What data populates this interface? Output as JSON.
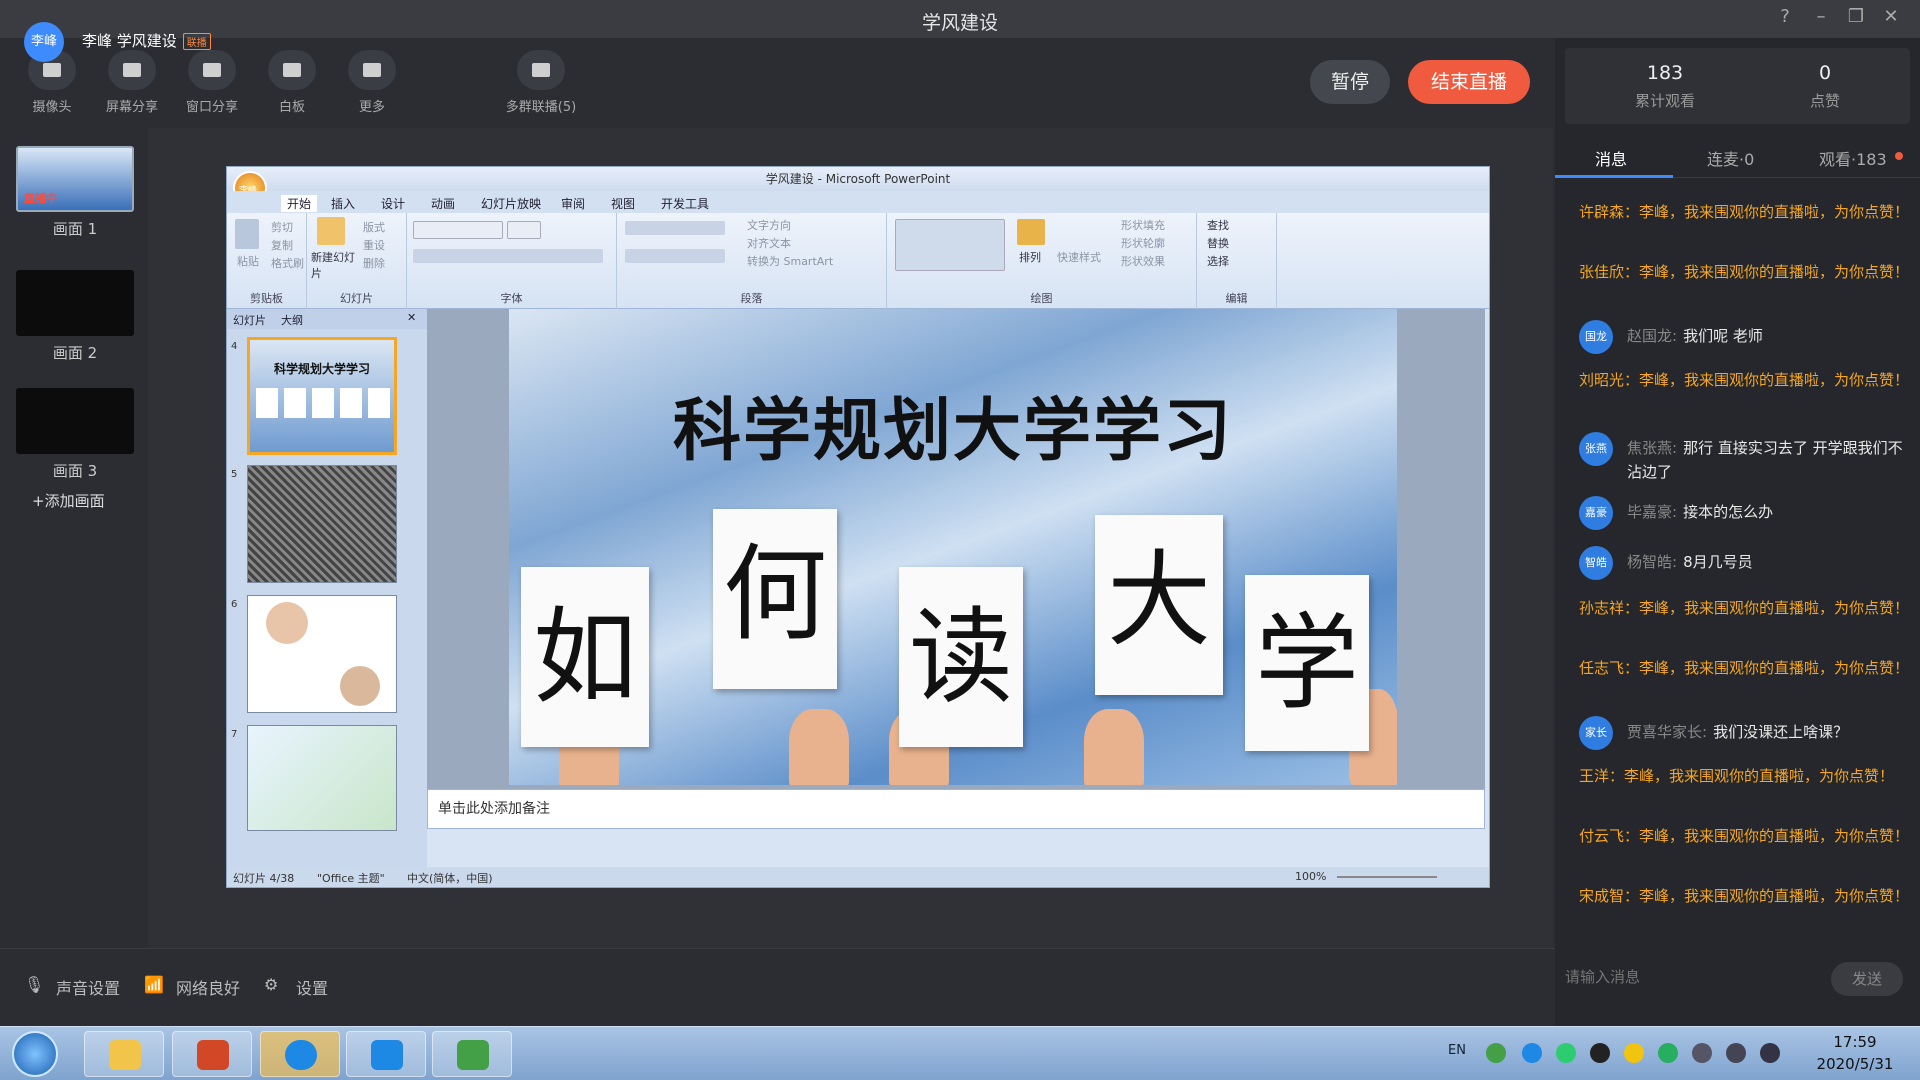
{
  "window": {
    "title": "学风建设"
  },
  "host": {
    "avatar_text": "李峰",
    "name_line": "李峰 学风建设",
    "tag": "联播"
  },
  "toolbar": {
    "tools": [
      {
        "label": "摄像头",
        "icon": "camera-icon"
      },
      {
        "label": "屏幕分享",
        "icon": "screen-share-icon"
      },
      {
        "label": "窗口分享",
        "icon": "window-share-icon"
      },
      {
        "label": "白板",
        "icon": "whiteboard-icon"
      },
      {
        "label": "更多",
        "icon": "grid-icon"
      },
      {
        "label": "多群联播(5)",
        "icon": "multi-group-icon"
      }
    ],
    "pause": "暂停",
    "end_live": "结束直播"
  },
  "scenes": {
    "items": [
      {
        "label": "画面 1",
        "badge": "直播中"
      },
      {
        "label": "画面 2"
      },
      {
        "label": "画面 3"
      }
    ],
    "add": "+添加画面"
  },
  "ppt": {
    "title": "学风建设 - Microsoft PowerPoint",
    "office_badge": "李峰",
    "tabs": [
      "开始",
      "插入",
      "设计",
      "动画",
      "幻灯片放映",
      "审阅",
      "视图",
      "开发工具"
    ],
    "ribbon": {
      "clipboard": {
        "label": "剪贴板",
        "paste": "粘贴",
        "cut": "剪切",
        "copy": "复制",
        "painter": "格式刷"
      },
      "slides": {
        "label": "幻灯片",
        "new_slide": "新建幻灯片",
        "layout": "版式",
        "reset": "重设",
        "delete": "删除"
      },
      "font": {
        "label": "字体"
      },
      "paragraph": {
        "label": "段落",
        "direction": "文字方向",
        "align": "对齐文本",
        "smartart": "转换为 SmartArt"
      },
      "drawing": {
        "label": "绘图",
        "arrange": "排列",
        "quick": "快速样式",
        "fill": "形状填充",
        "outline": "形状轮廓",
        "effect": "形状效果"
      },
      "editing": {
        "label": "编辑",
        "find": "查找",
        "replace": "替换",
        "select": "选择"
      }
    },
    "pane_tabs": [
      "幻灯片",
      "大纲"
    ],
    "thumbs": [
      {
        "num": "4",
        "title": "科学规划大学学习"
      },
      {
        "num": "5"
      },
      {
        "num": "6"
      },
      {
        "num": "7"
      }
    ],
    "slide": {
      "title": "科学规划大学学习",
      "cards": [
        "如",
        "何",
        "读",
        "大",
        "学"
      ]
    },
    "notes_placeholder": "单击此处添加备注",
    "status": {
      "slide": "幻灯片 4/38",
      "theme": "\"Office 主题\"",
      "lang": "中文(简体，中国)",
      "zoom": "100%"
    }
  },
  "right": {
    "stats": [
      {
        "value": "183",
        "label": "累计观看"
      },
      {
        "value": "0",
        "label": "点赞"
      }
    ],
    "tabs": [
      "消息",
      "连麦·0",
      "观看·183"
    ],
    "chat": [
      {
        "type": "sys",
        "text": "许辟森：李峰，我来围观你的直播啦，为你点赞！"
      },
      {
        "type": "sys",
        "text": "张佳欣：李峰，我来围观你的直播啦，为你点赞！"
      },
      {
        "type": "user",
        "avatar": "国龙",
        "name": "赵国龙:",
        "text": "我们呢  老师"
      },
      {
        "type": "sys",
        "text": "刘昭光：李峰，我来围观你的直播啦，为你点赞！"
      },
      {
        "type": "user",
        "avatar": "张燕",
        "name": "焦张燕:",
        "text": "那行 直接实习去了 开学跟我们不沾边了"
      },
      {
        "type": "user",
        "avatar": "嘉豪",
        "name": "毕嘉豪:",
        "text": "接本的怎么办"
      },
      {
        "type": "user",
        "avatar": "智皓",
        "name": "杨智皓:",
        "text": "8月几号员"
      },
      {
        "type": "sys",
        "text": "孙志祥：李峰，我来围观你的直播啦，为你点赞！"
      },
      {
        "type": "sys",
        "text": "任志飞：李峰，我来围观你的直播啦，为你点赞！"
      },
      {
        "type": "user",
        "avatar": "家长",
        "name": "贾喜华家长:",
        "text": "我们没课还上啥课？"
      },
      {
        "type": "sys",
        "text": "王洋：李峰，我来围观你的直播啦，为你点赞！"
      },
      {
        "type": "sys",
        "text": "付云飞：李峰，我来围观你的直播啦，为你点赞！"
      },
      {
        "type": "sys",
        "text": "宋成智：李峰，我来围观你的直播啦，为你点赞！"
      }
    ],
    "input_placeholder": "请输入消息",
    "send": "发送"
  },
  "bottom": {
    "sound": "声音设置",
    "network": "网络良好",
    "settings": "设置"
  },
  "taskbar": {
    "lang": "EN",
    "time": "17:59",
    "date": "2020/5/31"
  },
  "colors": {
    "accent": "#3d8bfd",
    "end_live": "#f05a3e",
    "system_msg": "#f5a623"
  }
}
